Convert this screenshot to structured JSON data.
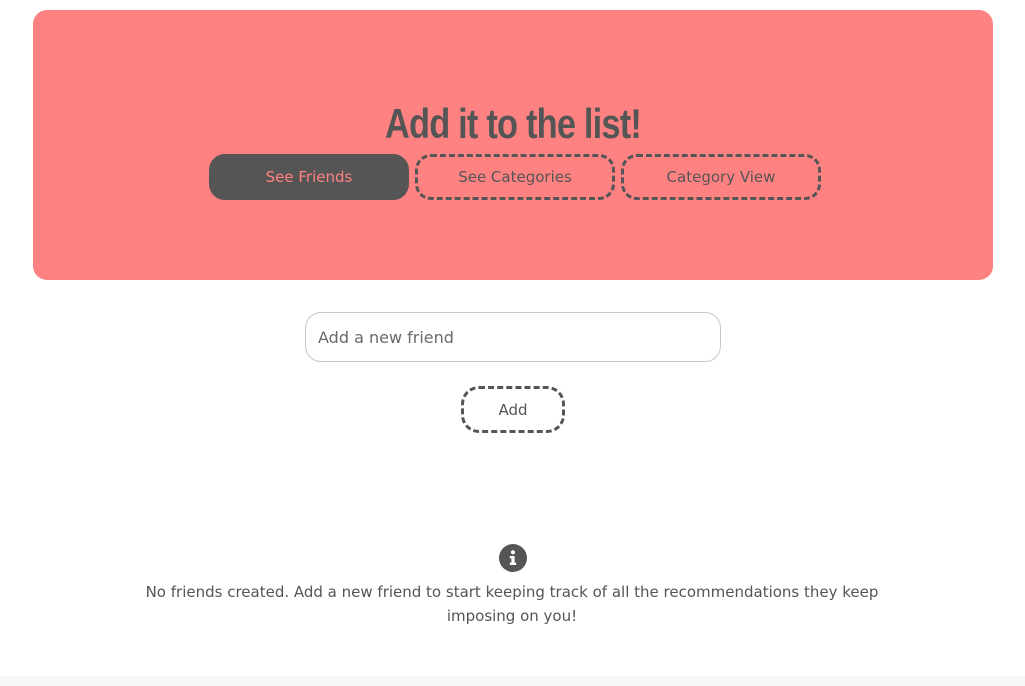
{
  "header": {
    "title": "Add it to the list!"
  },
  "nav": {
    "items": [
      {
        "label": "See Friends",
        "active": true
      },
      {
        "label": "See Categories",
        "active": false
      },
      {
        "label": "Category View",
        "active": false
      }
    ]
  },
  "form": {
    "placeholder": "Add a new friend",
    "value": "",
    "add_label": "Add"
  },
  "empty_state": {
    "icon": "info-icon",
    "message": "No friends created. Add a new friend to start keeping track of all the recommendations they keep imposing on you!"
  },
  "colors": {
    "accent": "#ff8282",
    "dark": "#555555"
  }
}
